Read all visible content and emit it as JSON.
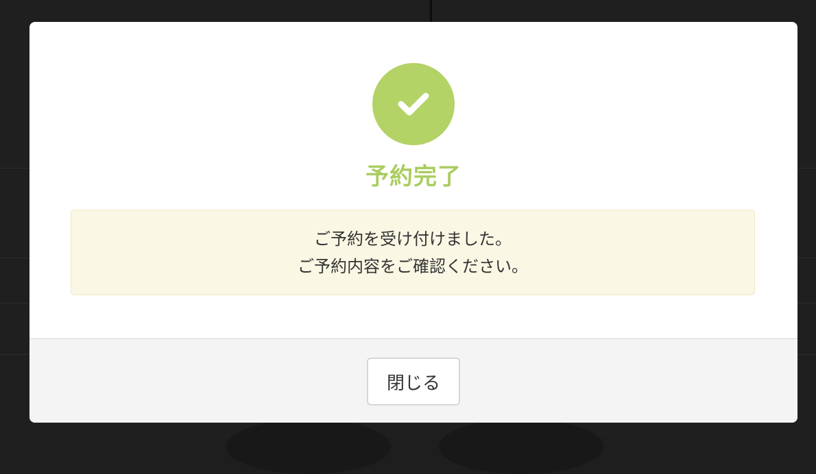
{
  "modal": {
    "icon": "check-icon",
    "title": "予約完了",
    "message_lines": [
      "ご予約を受け付けました。",
      "ご予約内容をご確認ください。"
    ],
    "close_label": "閉じる"
  },
  "colors": {
    "accent": "#b3d366",
    "title": "#aacd5f",
    "message_background": "#faf7e4",
    "footer_background": "#f4f4f4",
    "overlay": "#1f1f1f"
  }
}
